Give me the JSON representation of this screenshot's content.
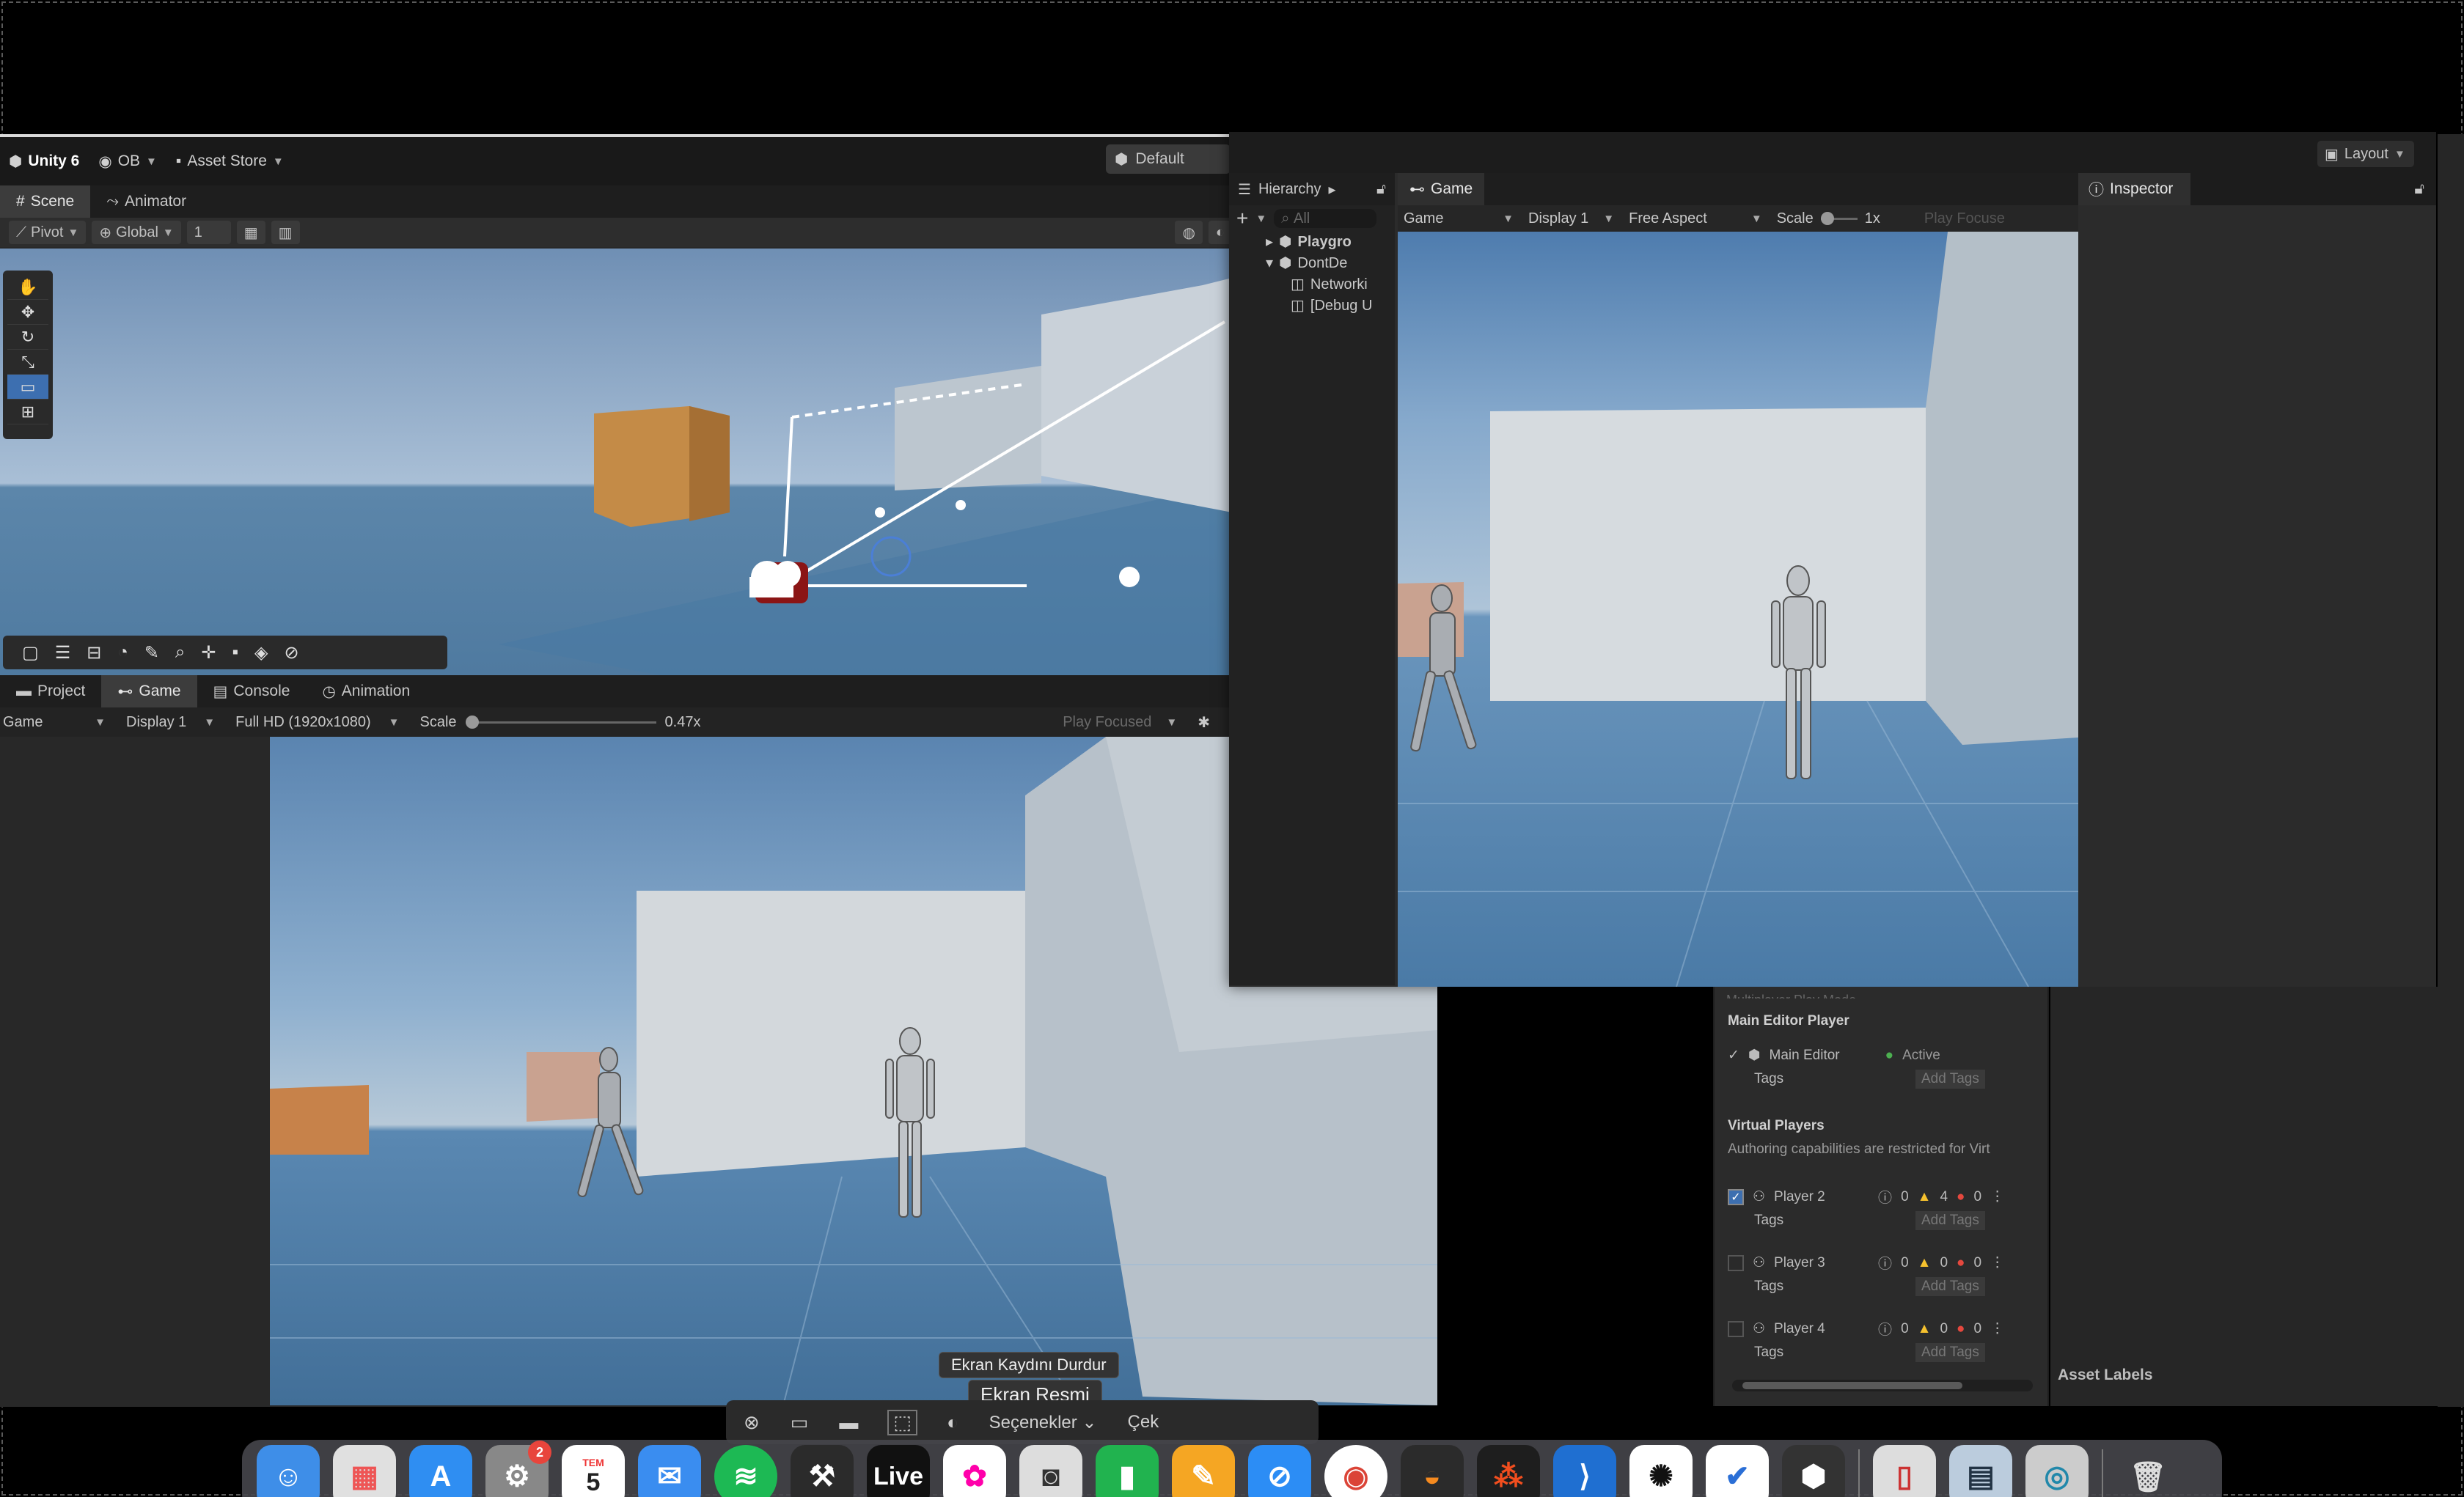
{
  "unity": {
    "topbar": {
      "product": "Unity 6",
      "account": "OB",
      "asset_store": "Asset Store",
      "layout_button": "Default"
    },
    "scene_tabs": [
      "Scene",
      "Animator"
    ],
    "scene_toolbar": {
      "pivot": "Pivot",
      "global": "Global",
      "grid_value": "1"
    },
    "bottom_tabs": [
      "Project",
      "Game",
      "Console",
      "Animation"
    ],
    "bottom_toolbar": {
      "view": "Game",
      "display": "Display 1",
      "resolution": "Full HD (1920x1080)",
      "scale_label": "Scale",
      "scale_value": "0.47x",
      "play_focused": "Play Focused"
    }
  },
  "float_window": {
    "layout_button": "Layout",
    "hierarchy": {
      "tab": "Hierarchy",
      "search_placeholder": "All",
      "items": [
        "Playgro",
        "DontDe",
        "Networki",
        "[Debug U"
      ]
    },
    "game": {
      "tab": "Game",
      "view": "Game",
      "display": "Display 1",
      "aspect": "Free Aspect",
      "scale_label": "Scale",
      "scale_value": "1x",
      "play_focused": "Play Focuse"
    },
    "inspector": {
      "tab": "Inspector"
    }
  },
  "multiplayer": {
    "cut_header": "Multiplayer Play Mode",
    "main_header": "Main Editor Player",
    "main_player": {
      "name": "Main Editor",
      "status": "Active",
      "tags_label": "Tags",
      "tags_button": "Add Tags"
    },
    "virtual_header": "Virtual Players",
    "virtual_note": "Authoring capabilities are restricted for Virt",
    "players": [
      {
        "name": "Player 2",
        "checked": true,
        "info": "0",
        "warn": "4",
        "err": "0",
        "tags_label": "Tags",
        "tags_button": "Add Tags"
      },
      {
        "name": "Player 3",
        "checked": false,
        "info": "0",
        "warn": "0",
        "err": "0",
        "tags_label": "Tags",
        "tags_button": "Add Tags"
      },
      {
        "name": "Player 4",
        "checked": false,
        "info": "0",
        "warn": "0",
        "err": "0",
        "tags_label": "Tags",
        "tags_button": "Add Tags"
      }
    ],
    "asset_labels": "Asset Labels"
  },
  "screenshot_tool": {
    "tooltip_stop": "Ekran Kaydını Durdur",
    "tooltip_shot": "Ekran Resmi",
    "options": "Seçenekler",
    "capture": "Çek"
  },
  "dock": {
    "calendar_month": "TEM",
    "calendar_day": "5",
    "settings_badge": "2",
    "live_label": "Live",
    "apps": [
      "finder",
      "launchpad",
      "app-store",
      "system-settings",
      "calendar",
      "mail",
      "spotify",
      "instruments",
      "live",
      "photos",
      "screenshot",
      "numbers",
      "pages",
      "safari",
      "chrome",
      "blender",
      "figma",
      "vscode",
      "chatgpt",
      "tasks",
      "unity-hub",
      "iphone-mirroring",
      "preview",
      "quicktime",
      "trash"
    ]
  },
  "colors": {
    "editor_bg": "#282828",
    "toolbar": "#191919",
    "tab_active": "#3c3c3c",
    "accent_blue": "#3d7bd8"
  }
}
